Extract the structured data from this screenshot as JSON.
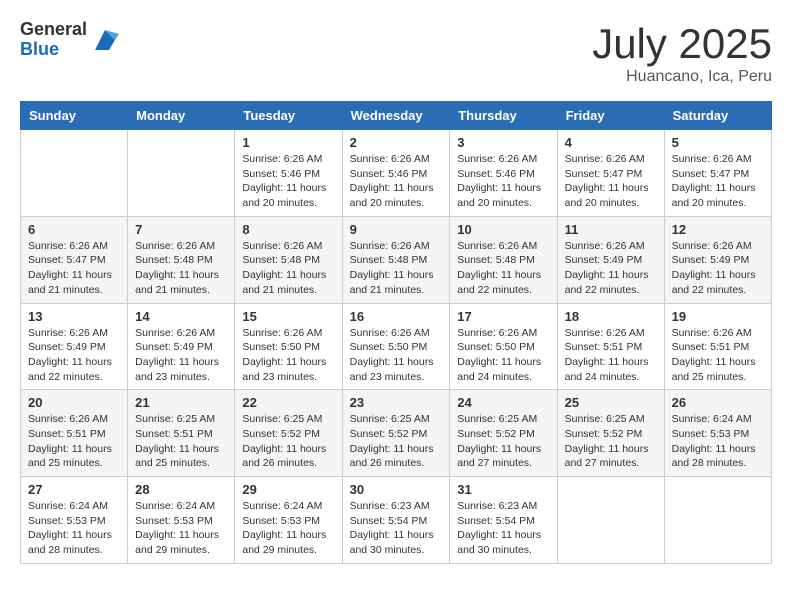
{
  "header": {
    "logo_general": "General",
    "logo_blue": "Blue",
    "month_title": "July 2025",
    "subtitle": "Huancano, Ica, Peru"
  },
  "days_of_week": [
    "Sunday",
    "Monday",
    "Tuesday",
    "Wednesday",
    "Thursday",
    "Friday",
    "Saturday"
  ],
  "weeks": [
    [
      {
        "day": "",
        "info": ""
      },
      {
        "day": "",
        "info": ""
      },
      {
        "day": "1",
        "info": "Sunrise: 6:26 AM\nSunset: 5:46 PM\nDaylight: 11 hours and 20 minutes."
      },
      {
        "day": "2",
        "info": "Sunrise: 6:26 AM\nSunset: 5:46 PM\nDaylight: 11 hours and 20 minutes."
      },
      {
        "day": "3",
        "info": "Sunrise: 6:26 AM\nSunset: 5:46 PM\nDaylight: 11 hours and 20 minutes."
      },
      {
        "day": "4",
        "info": "Sunrise: 6:26 AM\nSunset: 5:47 PM\nDaylight: 11 hours and 20 minutes."
      },
      {
        "day": "5",
        "info": "Sunrise: 6:26 AM\nSunset: 5:47 PM\nDaylight: 11 hours and 20 minutes."
      }
    ],
    [
      {
        "day": "6",
        "info": "Sunrise: 6:26 AM\nSunset: 5:47 PM\nDaylight: 11 hours and 21 minutes."
      },
      {
        "day": "7",
        "info": "Sunrise: 6:26 AM\nSunset: 5:48 PM\nDaylight: 11 hours and 21 minutes."
      },
      {
        "day": "8",
        "info": "Sunrise: 6:26 AM\nSunset: 5:48 PM\nDaylight: 11 hours and 21 minutes."
      },
      {
        "day": "9",
        "info": "Sunrise: 6:26 AM\nSunset: 5:48 PM\nDaylight: 11 hours and 21 minutes."
      },
      {
        "day": "10",
        "info": "Sunrise: 6:26 AM\nSunset: 5:48 PM\nDaylight: 11 hours and 22 minutes."
      },
      {
        "day": "11",
        "info": "Sunrise: 6:26 AM\nSunset: 5:49 PM\nDaylight: 11 hours and 22 minutes."
      },
      {
        "day": "12",
        "info": "Sunrise: 6:26 AM\nSunset: 5:49 PM\nDaylight: 11 hours and 22 minutes."
      }
    ],
    [
      {
        "day": "13",
        "info": "Sunrise: 6:26 AM\nSunset: 5:49 PM\nDaylight: 11 hours and 22 minutes."
      },
      {
        "day": "14",
        "info": "Sunrise: 6:26 AM\nSunset: 5:49 PM\nDaylight: 11 hours and 23 minutes."
      },
      {
        "day": "15",
        "info": "Sunrise: 6:26 AM\nSunset: 5:50 PM\nDaylight: 11 hours and 23 minutes."
      },
      {
        "day": "16",
        "info": "Sunrise: 6:26 AM\nSunset: 5:50 PM\nDaylight: 11 hours and 23 minutes."
      },
      {
        "day": "17",
        "info": "Sunrise: 6:26 AM\nSunset: 5:50 PM\nDaylight: 11 hours and 24 minutes."
      },
      {
        "day": "18",
        "info": "Sunrise: 6:26 AM\nSunset: 5:51 PM\nDaylight: 11 hours and 24 minutes."
      },
      {
        "day": "19",
        "info": "Sunrise: 6:26 AM\nSunset: 5:51 PM\nDaylight: 11 hours and 25 minutes."
      }
    ],
    [
      {
        "day": "20",
        "info": "Sunrise: 6:26 AM\nSunset: 5:51 PM\nDaylight: 11 hours and 25 minutes."
      },
      {
        "day": "21",
        "info": "Sunrise: 6:25 AM\nSunset: 5:51 PM\nDaylight: 11 hours and 25 minutes."
      },
      {
        "day": "22",
        "info": "Sunrise: 6:25 AM\nSunset: 5:52 PM\nDaylight: 11 hours and 26 minutes."
      },
      {
        "day": "23",
        "info": "Sunrise: 6:25 AM\nSunset: 5:52 PM\nDaylight: 11 hours and 26 minutes."
      },
      {
        "day": "24",
        "info": "Sunrise: 6:25 AM\nSunset: 5:52 PM\nDaylight: 11 hours and 27 minutes."
      },
      {
        "day": "25",
        "info": "Sunrise: 6:25 AM\nSunset: 5:52 PM\nDaylight: 11 hours and 27 minutes."
      },
      {
        "day": "26",
        "info": "Sunrise: 6:24 AM\nSunset: 5:53 PM\nDaylight: 11 hours and 28 minutes."
      }
    ],
    [
      {
        "day": "27",
        "info": "Sunrise: 6:24 AM\nSunset: 5:53 PM\nDaylight: 11 hours and 28 minutes."
      },
      {
        "day": "28",
        "info": "Sunrise: 6:24 AM\nSunset: 5:53 PM\nDaylight: 11 hours and 29 minutes."
      },
      {
        "day": "29",
        "info": "Sunrise: 6:24 AM\nSunset: 5:53 PM\nDaylight: 11 hours and 29 minutes."
      },
      {
        "day": "30",
        "info": "Sunrise: 6:23 AM\nSunset: 5:54 PM\nDaylight: 11 hours and 30 minutes."
      },
      {
        "day": "31",
        "info": "Sunrise: 6:23 AM\nSunset: 5:54 PM\nDaylight: 11 hours and 30 minutes."
      },
      {
        "day": "",
        "info": ""
      },
      {
        "day": "",
        "info": ""
      }
    ]
  ]
}
